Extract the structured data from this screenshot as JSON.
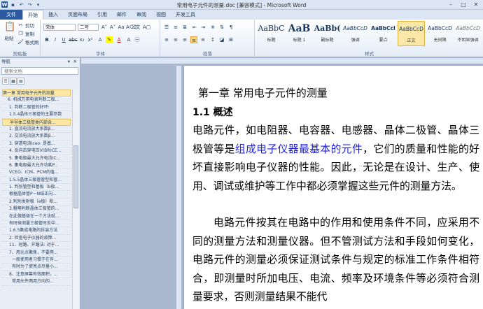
{
  "window": {
    "title": "常用电子元件的测量.doc [兼容模式] - Microsoft Word"
  },
  "tabs": [
    "文件",
    "开始",
    "插入",
    "页面布局",
    "引用",
    "邮件",
    "审阅",
    "视图",
    "开发工具"
  ],
  "ribbon": {
    "clipboard": {
      "label": "剪贴板",
      "paste": "粘贴",
      "cut": "剪切",
      "copy": "复制",
      "format_painter": "格式刷"
    },
    "font": {
      "label": "字体",
      "font_name": "宋体",
      "font_size": "二号"
    },
    "paragraph": {
      "label": "段落"
    },
    "styles": {
      "label": "样式",
      "items": [
        {
          "preview": "AaBbC",
          "name": "标题"
        },
        {
          "preview": "AaB",
          "name": "标题 1"
        },
        {
          "preview": "AaBb(",
          "name": "副标题"
        },
        {
          "preview": "AaBbCcD",
          "name": "强调"
        },
        {
          "preview": "AaBbCcI",
          "name": "要点"
        },
        {
          "preview": "AaBbCcD",
          "name": "正文"
        },
        {
          "preview": "AaBbCcD",
          "name": "无间隔"
        },
        {
          "preview": "AaBbCcD",
          "name": "不明显强调"
        }
      ]
    }
  },
  "nav": {
    "title": "导航",
    "search_placeholder": "搜索文档",
    "items": [
      "第一章  常用电子元件的测量",
      "6. 机械万用电表判断二极...",
      "1. 判断二极管的好坏:",
      "1.5.4晶体三极管的主要参数",
      "半导体三极管类内部含...",
      "1. 直流电流放大系数β...",
      "2. 交流电流放大系数β...",
      "3. 穿透电流Iceo: 是基...",
      "4. 反向击穿电压V(BR)CE...",
      "5. 集电极最大允许电流IC...",
      "6. 集电极最大允许功耗P...",
      "VCEO、ICM、PCM的值...",
      "1.5.5晶体三极管管型和管...",
      "1. 判别管型和基极（b极...",
      "根据晶体管P－N结正向...",
      "2.判别发射极（e极）和...",
      "3.粗略判断晶体三极管的...",
      "在此做基极在一个方法就...",
      "有时候测量三极管时反中...",
      "1.6.5集成电路的拆装方法",
      "2. 检查电子仪器的故障...",
      "11、短路、开路法: 对于...",
      "7、用光点聚焦，不要用...",
      "一般使用者习惯于在有...",
      "有时为了使亮点尽量小...",
      "8、注意屏幕有效面积，...",
      "常用元件两用方向的..."
    ]
  },
  "document": {
    "heading": "第一章   常用电子元件的测量",
    "subhead": "1.1  概述",
    "para1_a": "电路元件，如电阻器、电容器、电感器、晶体二极管、晶体三极管等是",
    "para1_blue": "组成电子仪器最基本的元件",
    "para1_b": "，它们的质量和性能的好坏直接影响电子仪器的性能。因此，无论是在设计、生产、使用、调试或维护等工作中都必须掌握这些元件的测量方法。",
    "para2": "电路元件按其在电路中的作用和使用条件不同，应采用不同的测量方法和测量仪器。但不管测试方法和手段如何变化，电路元件的测量必须保证测试条件与规定的标准工作条件相符合，即测量时所加电压、电流、频率及环境条件等必须符合测量要求，否则测量结果不能代"
  }
}
